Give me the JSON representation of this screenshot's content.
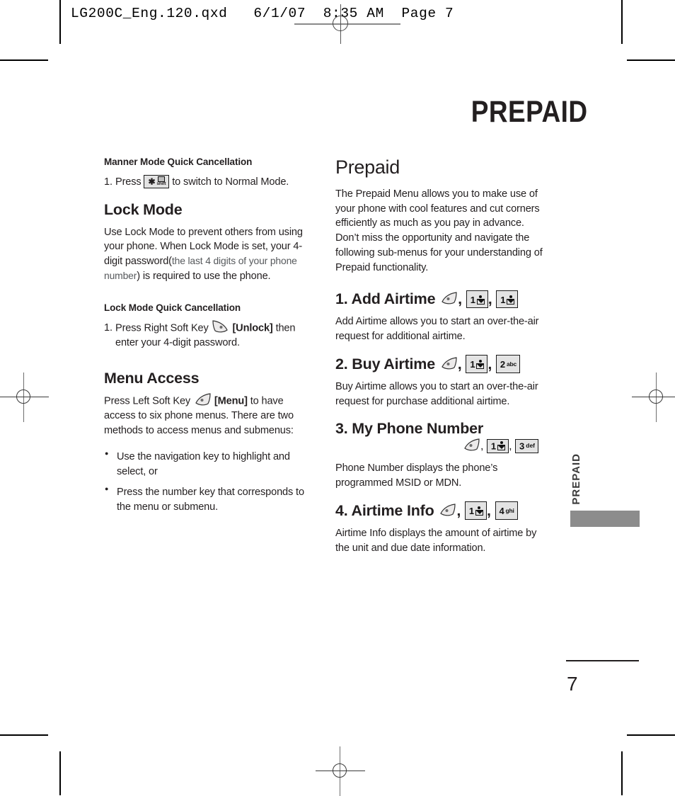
{
  "printer": {
    "file_strip": "LG200C_Eng.120.qxd   6/1/07  8:35 AM  Page 7"
  },
  "page": {
    "running_head": "PREPAID",
    "tab_label": "PREPAID",
    "folio": "7"
  },
  "left_column": {
    "manner_mode": {
      "heading": "Manner Mode Quick Cancellation",
      "step_number": "1.",
      "step_text_before": "Press",
      "step_text_after": "to switch to Normal Mode.",
      "key": {
        "digit": "✱",
        "label": "shift",
        "name": "star-shift-key"
      }
    },
    "lock_mode": {
      "heading": "Lock Mode",
      "body_part1": "Use Lock Mode to prevent others from using your phone. When Lock Mode is set, your 4-digit password(",
      "body_muted": "the last 4 digits of your phone number",
      "body_part2": ") is required to use the phone."
    },
    "lock_quick": {
      "heading": "Lock Mode Quick Cancellation",
      "step_number": "1.",
      "step_text_before": "Press Right Soft Key",
      "bracket_label": "[Unlock]",
      "step_text_after": "then enter your 4-digit password."
    },
    "menu_access": {
      "heading": "Menu Access",
      "body_before": "Press Left Soft Key",
      "bracket_label": "[Menu]",
      "body_after": "to have access to six phone menus. There are two methods to access menus and submenus:",
      "bullets": [
        "Use the navigation key to highlight and select, or",
        "Press the number key that corresponds to the menu or submenu."
      ]
    }
  },
  "right_column": {
    "title": "Prepaid",
    "intro": "The Prepaid Menu allows you to make use of your phone with cool features and cut corners efficiently as much as you pay in advance. Don’t miss the opportunity and navigate the following sub-menus for your understanding of Prepaid functionality.",
    "sections": [
      {
        "heading": "1. Add Airtime",
        "keys": [
          {
            "type": "softkey",
            "name": "left-soft-key-icon"
          },
          {
            "type": "key",
            "digit": "1",
            "label": "voicemail",
            "name": "key-1"
          },
          {
            "type": "key",
            "digit": "1",
            "label": "voicemail",
            "name": "key-1"
          }
        ],
        "body": "Add Airtime allows you to start an over-the-air request for additional airtime.",
        "wrap_keys": false
      },
      {
        "heading": "2. Buy Airtime",
        "keys": [
          {
            "type": "softkey",
            "name": "left-soft-key-icon"
          },
          {
            "type": "key",
            "digit": "1",
            "label": "voicemail",
            "name": "key-1"
          },
          {
            "type": "key",
            "digit": "2",
            "label": "abc",
            "name": "key-2"
          }
        ],
        "body": "Buy Airtime allows you to start an over-the-air request for purchase additional airtime.",
        "wrap_keys": false
      },
      {
        "heading": "3. My Phone Number",
        "keys": [
          {
            "type": "softkey",
            "name": "left-soft-key-icon"
          },
          {
            "type": "key",
            "digit": "1",
            "label": "voicemail",
            "name": "key-1"
          },
          {
            "type": "key",
            "digit": "3",
            "label": "def",
            "name": "key-3"
          }
        ],
        "body": "Phone Number displays the phone’s programmed MSID or MDN.",
        "wrap_keys": true
      },
      {
        "heading": "4. Airtime Info",
        "keys": [
          {
            "type": "softkey",
            "name": "left-soft-key-icon"
          },
          {
            "type": "key",
            "digit": "1",
            "label": "voicemail",
            "name": "key-1"
          },
          {
            "type": "key",
            "digit": "4",
            "label": "ghi",
            "name": "key-4"
          }
        ],
        "body": "Airtime Info displays the amount of airtime by the unit and due date information.",
        "wrap_keys": false
      }
    ],
    "key_separator": ","
  },
  "colors": {
    "ink": "#231f20",
    "muted_ink": "#56595c",
    "tab_gray": "#8c8c8c",
    "key_face": "#e3e3e3"
  }
}
